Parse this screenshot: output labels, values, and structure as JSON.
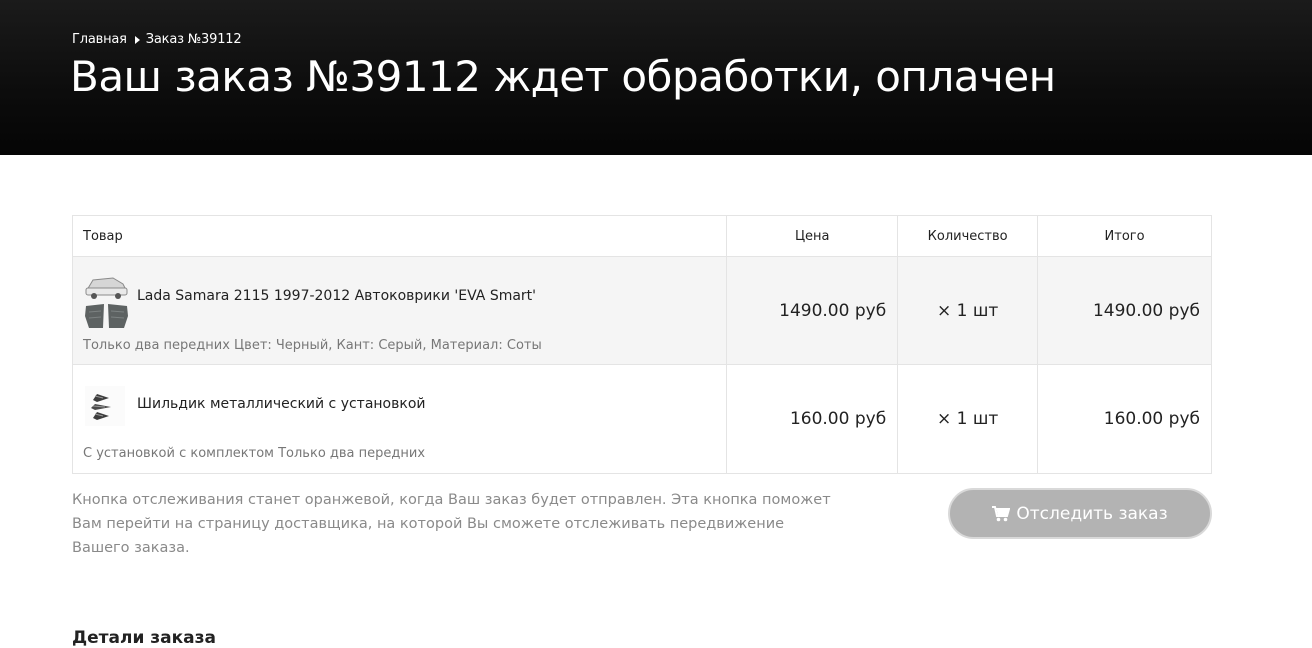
{
  "breadcrumb": {
    "home": "Главная",
    "current": "Заказ №39112"
  },
  "page_title": "Ваш заказ №39112 ждет обработки, оплачен",
  "table": {
    "headers": {
      "product": "Товар",
      "price": "Цена",
      "qty": "Количество",
      "total": "Итого"
    },
    "rows": [
      {
        "name": "Lada Samara 2115 1997-2012 Автоковрики 'EVA Smart'",
        "options": "Только два передних Цвет: Черный, Кант: Серый, Материал: Соты",
        "price": "1490.00 руб",
        "qty": "× 1 шт",
        "total": "1490.00 руб",
        "thumb_icon": "car-mats-thumbnail"
      },
      {
        "name": "Шильдик металлический с установкой",
        "options": "С установкой с комплектом Только два передних",
        "price": "160.00 руб",
        "qty": "× 1 шт",
        "total": "160.00 руб",
        "thumb_icon": "badge-thumbnail"
      }
    ]
  },
  "tracking": {
    "note": "Кнопка отслеживания станет оранжевой, когда Ваш заказ будет отправлен. Эта кнопка поможет Вам перейти на страницу доставщика, на которой Вы сможете отслеживать передвижение Вашего заказа.",
    "button_label": "Отследить заказ",
    "button_icon": "shopping-cart-icon"
  },
  "details_heading": "Детали заказа",
  "colors": {
    "header_bg": "#0c0c0c",
    "button_disabled": "#b3b3b3",
    "row_alt": "#f5f5f5"
  }
}
